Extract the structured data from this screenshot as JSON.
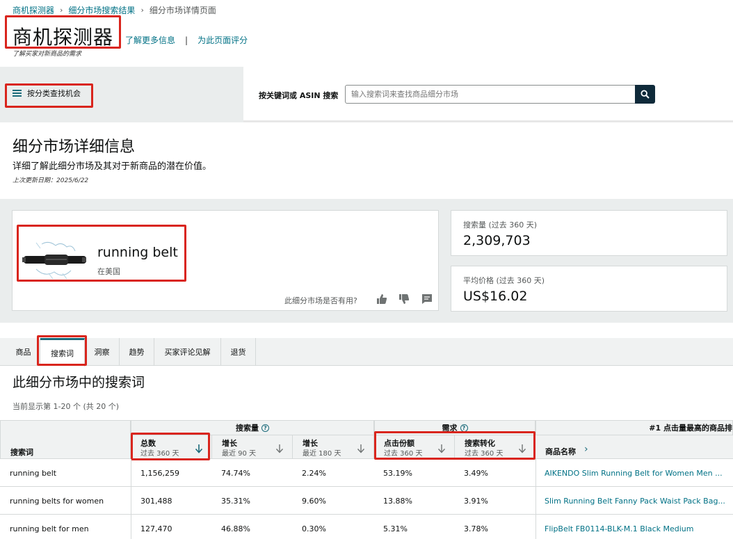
{
  "breadcrumb": [
    "商机探测器",
    "细分市场搜索结果",
    "细分市场详情页面"
  ],
  "header": {
    "title": "商机探测器",
    "subtitle": "了解买家对新商品的需求",
    "learn_more": "了解更多信息",
    "divider": "|",
    "rate_page": "为此页面评分"
  },
  "search": {
    "category_button": "按分类查找机会",
    "label": "按关键词或 ASIN 搜索",
    "placeholder": "输入搜索词来查找商品细分市场"
  },
  "niche": {
    "title": "细分市场详细信息",
    "description": "详细了解此细分市场及其对于新商品的潜在价值。",
    "updated": "上次更新日期：2025/6/22"
  },
  "product": {
    "name": "running belt",
    "locale": "在美国",
    "useful_question": "此细分市场是否有用?"
  },
  "stats": [
    {
      "label": "搜索量 (过去 360 天)",
      "value": "2,309,703"
    },
    {
      "label": "平均价格 (过去 360 天)",
      "value": "US$16.02"
    }
  ],
  "tabs": [
    "商品",
    "搜索词",
    "洞察",
    "趋势",
    "买家评论见解",
    "退货"
  ],
  "section": {
    "title": "此细分市场中的搜索词",
    "showing": "当前显示第 1-20 个 (共 20 个)"
  },
  "table": {
    "group_headers": {
      "search_volume": "搜索量",
      "demand": "需求",
      "top_product": "#1 点击量最高的商品排"
    },
    "first_col": "搜索词",
    "columns": [
      {
        "main": "总数",
        "minor": "过去 360 天"
      },
      {
        "main": "增长",
        "minor": "最近 90 天"
      },
      {
        "main": "增长",
        "minor": "最近 180 天"
      },
      {
        "main": "点击份额",
        "minor": "过去 360 天"
      },
      {
        "main": "搜索转化",
        "minor": "过去 360 天"
      },
      {
        "main": "商品名称",
        "minor": ""
      }
    ],
    "rows": [
      {
        "term": "running belt",
        "total": "1,156,259",
        "g90": "74.74%",
        "g180": "2.24%",
        "click": "53.19%",
        "conv": "3.49%",
        "product": "AIKENDO Slim Running Belt for Women Men ..."
      },
      {
        "term": "running belts for women",
        "total": "301,488",
        "g90": "35.31%",
        "g180": "9.60%",
        "click": "13.88%",
        "conv": "3.91%",
        "product": "Slim Running Belt Fanny Pack Waist Pack Bag..."
      },
      {
        "term": "running belt for men",
        "total": "127,470",
        "g90": "46.88%",
        "g180": "0.30%",
        "click": "5.31%",
        "conv": "3.78%",
        "product": "FlipBelt FB0114-BLK-M.1 Black Medium"
      }
    ]
  },
  "colors": {
    "accent": "#007185",
    "highlight": "#d9251d",
    "band": "#eaeded"
  }
}
